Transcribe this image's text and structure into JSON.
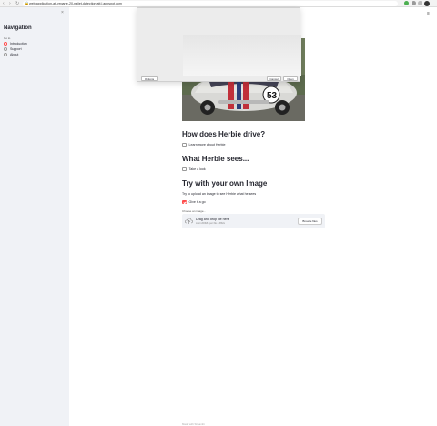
{
  "browser": {
    "url": "web-application-att-regarte-20-naijet-datection.att.l.appspot.com"
  },
  "sidebar": {
    "title": "Navigation",
    "radio_label": "Go to",
    "items": [
      {
        "label": "Introduction",
        "selected": true
      },
      {
        "label": "Support",
        "selected": false
      },
      {
        "label": "About",
        "selected": false
      }
    ]
  },
  "dialog": {
    "options_label": "Options",
    "cancel_label": "Cancel",
    "open_label": "Open"
  },
  "main": {
    "sections": [
      {
        "heading": "How does Herbie drive?",
        "checkbox": "Learn more about Herbie",
        "checked": false
      },
      {
        "heading": "What Herbie sees...",
        "checkbox": "Take a look",
        "checked": false
      }
    ],
    "upload": {
      "heading": "Try with your own Image",
      "description": "Try to upload an image to see Herbie what he sees",
      "checkbox": "Give it a go",
      "checked": true,
      "choose_label": "Choose an image...",
      "drop_title": "Drag and drop file here",
      "drop_limit": "Limit 200MB per file • JPEG",
      "browse_label": "Browse files"
    }
  },
  "footer": "Made with Streamlit",
  "colors": {
    "accent": "#ff4b4b",
    "sidebar_bg": "#f0f2f6"
  }
}
